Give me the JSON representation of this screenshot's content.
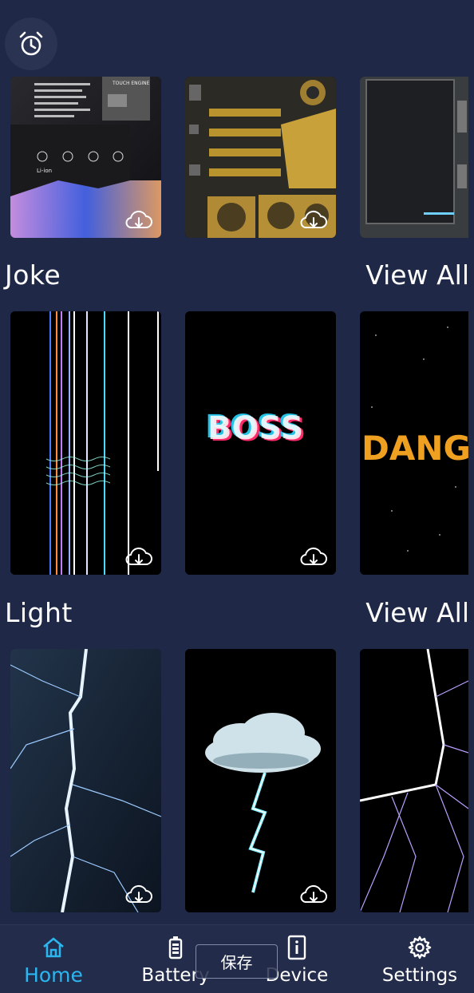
{
  "header": {
    "alarm_icon": "alarm-clock-icon"
  },
  "sections": [
    {
      "title": "Joke",
      "view_all": "View All"
    },
    {
      "title": "Light",
      "view_all": "View All"
    }
  ],
  "row0_text": {
    "battery_label": "TOUCH ENGINE",
    "battery_type": "Li-ion"
  },
  "joke_text": {
    "boss": "BOSS",
    "danger": "DANGE"
  },
  "bottom_nav": {
    "items": [
      {
        "label": "Home",
        "icon": "home-icon",
        "active": true
      },
      {
        "label": "Battery",
        "icon": "battery-icon",
        "active": false
      },
      {
        "label": "Device",
        "icon": "info-icon",
        "active": false
      },
      {
        "label": "Settings",
        "icon": "gear-icon",
        "active": false
      }
    ]
  },
  "toast": {
    "text": "保存"
  },
  "colors": {
    "background": "#1f2846",
    "accent": "#2bb6f0",
    "nav_bg": "#232c4a"
  }
}
